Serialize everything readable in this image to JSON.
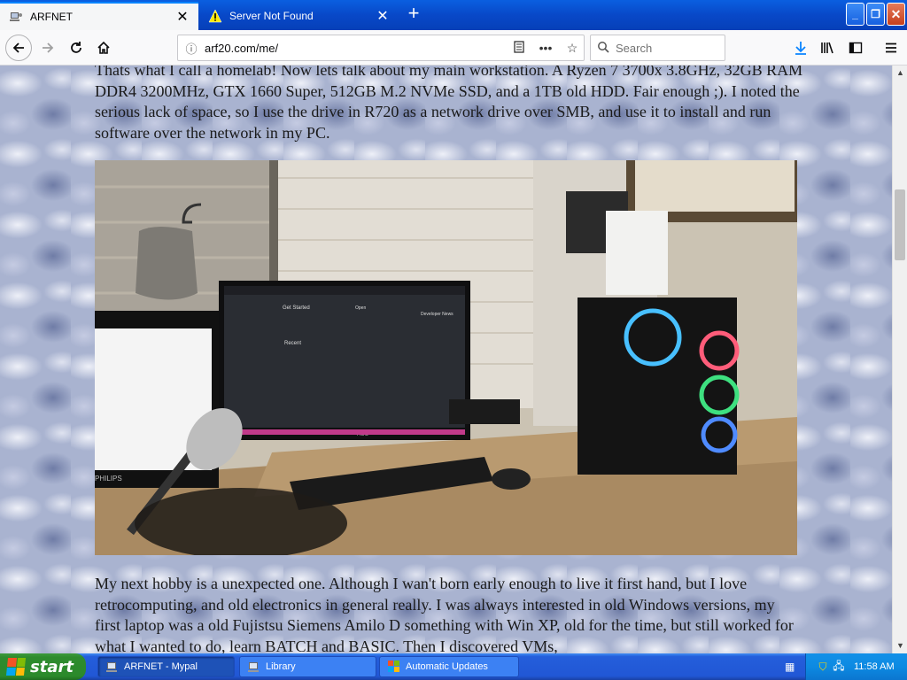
{
  "tabs": [
    {
      "title": "ARFNET",
      "icon": "site-favicon",
      "active": true
    },
    {
      "title": "Server Not Found",
      "icon": "warning-icon",
      "active": false
    }
  ],
  "window_controls": {
    "minimize": "_",
    "maximize": "❐",
    "close": "✕"
  },
  "nav": {
    "url": "arf20.com/me/",
    "search_placeholder": "Search"
  },
  "article": {
    "paragraph1": "Thats what I call a homelab! Now lets talk about my main workstation. A Ryzen 7 3700x 3.8GHz, 32GB RAM DDR4 3200MHz, GTX 1660 Super, 512GB M.2 NVMe SSD, and a 1TB old HDD. Fair enough ;). I noted the serious lack of space, so I use the drive in R720 as a network drive over SMB, and use it to install and run software over the network in my PC.",
    "paragraph2": "My next hobby is a unexpected one. Although I wan't born early enough to live it first hand, but I love retrocomputing, and old electronics in general really. I was always interested in old Windows versions, my first laptop was a old Fujistsu Siemens Amilo D something with Win XP, old for the time, but still worked for what I wanted to do, learn BATCH and BASIC. Then I discovered VMs,",
    "photo": {
      "screen_texts": [
        "Get Started",
        "Recent",
        "Open",
        "Developer News"
      ],
      "laptop_brand": "PHILIPS",
      "monitor_brand": "AOC"
    }
  },
  "taskbar": {
    "start_label": "start",
    "tasks": [
      {
        "label": "ARFNET - Mypal",
        "icon": "browser-icon",
        "active": true
      },
      {
        "label": "Library",
        "icon": "library-icon",
        "active": false
      },
      {
        "label": "Automatic Updates",
        "icon": "windows-update-icon",
        "active": false
      }
    ],
    "clock": "11:58 AM"
  },
  "colors": {
    "tab_bar": "#0848c8",
    "taskbar": "#245edb",
    "start_button": "#2e8b2e",
    "tray": "#0d8ae2",
    "page_background": "#a9b3d0"
  }
}
